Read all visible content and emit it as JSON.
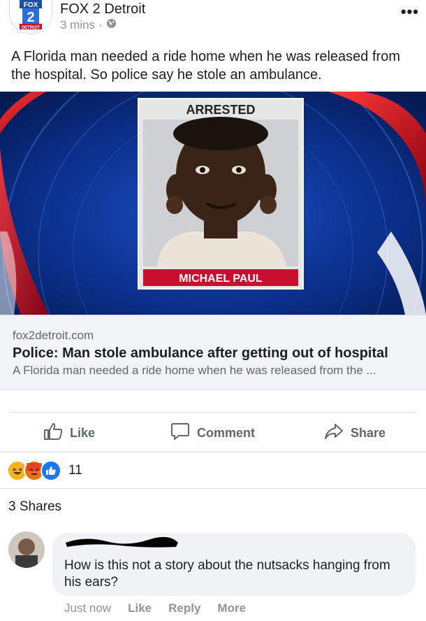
{
  "header": {
    "logo_text": "FOX 2",
    "logo_sub": "DETROIT",
    "page_name": "FOX 2 Detroit",
    "time": "3 mins",
    "separator": "·",
    "privacy_icon": "globe-icon",
    "more_icon": "ellipsis-icon"
  },
  "post": {
    "text": "A Florida man needed a ride home when he was released from the hospital. So police say he stole an ambulance."
  },
  "image": {
    "banner_top": "ARRESTED",
    "banner_bottom": "MICHAEL PAUL",
    "banner_color": "#c8102e",
    "bg_color": "#0b2f8a"
  },
  "link": {
    "domain": "fox2detroit.com",
    "title": "Police: Man stole ambulance after getting out of hospital",
    "description": "A Florida man needed a ride home when he was released from the ..."
  },
  "actions": [
    {
      "label": "Like",
      "icon": "thumbs-up-icon"
    },
    {
      "label": "Comment",
      "icon": "comment-icon"
    },
    {
      "label": "Share",
      "icon": "share-icon"
    }
  ],
  "reactions": {
    "icons": [
      "haha-icon",
      "angry-icon",
      "like-icon"
    ],
    "count": "11"
  },
  "shares": "3 Shares",
  "comment": {
    "text": "How is this not a story about the nutsacks hanging from his ears?",
    "time": "Just now",
    "like": "Like",
    "reply": "Reply",
    "more": "More"
  },
  "colors": {
    "accent_blue": "#1877f2",
    "angry_red": "#e9710f",
    "haha_yellow": "#f7b125"
  }
}
